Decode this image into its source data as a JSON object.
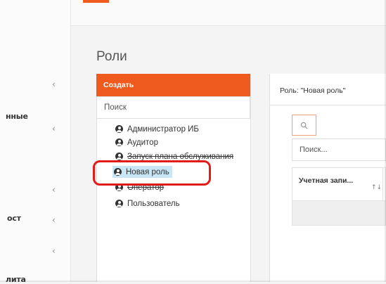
{
  "sidebar": {
    "items": [
      {
        "label": "нные",
        "chevron": "‹"
      },
      {
        "label": "ост",
        "chevron": "‹"
      },
      {
        "label": "лита",
        "chevron": ""
      }
    ],
    "chevrons": [
      "‹",
      "‹",
      "‹",
      "‹",
      "‹"
    ]
  },
  "page": {
    "title": "Роли"
  },
  "roles": {
    "create_label": "Создать",
    "search_placeholder": "Поиск",
    "items": [
      {
        "label": "Администратор ИБ"
      },
      {
        "label": "Аудитор"
      },
      {
        "label": "Запуск плана обслуживания"
      },
      {
        "label": "Новая роль",
        "selected": true
      },
      {
        "label": "Оператор"
      },
      {
        "label": "Пользователь"
      }
    ]
  },
  "detail": {
    "title": "Роль: \"Новая роль\"",
    "search_placeholder": "Поиск...",
    "column_account": "Учетная запи...",
    "sort_icon": "↑↓"
  },
  "colors": {
    "accent": "#ef5a1f",
    "highlight_ring": "#e21b1b",
    "selected_bg": "#c8e6f5"
  }
}
